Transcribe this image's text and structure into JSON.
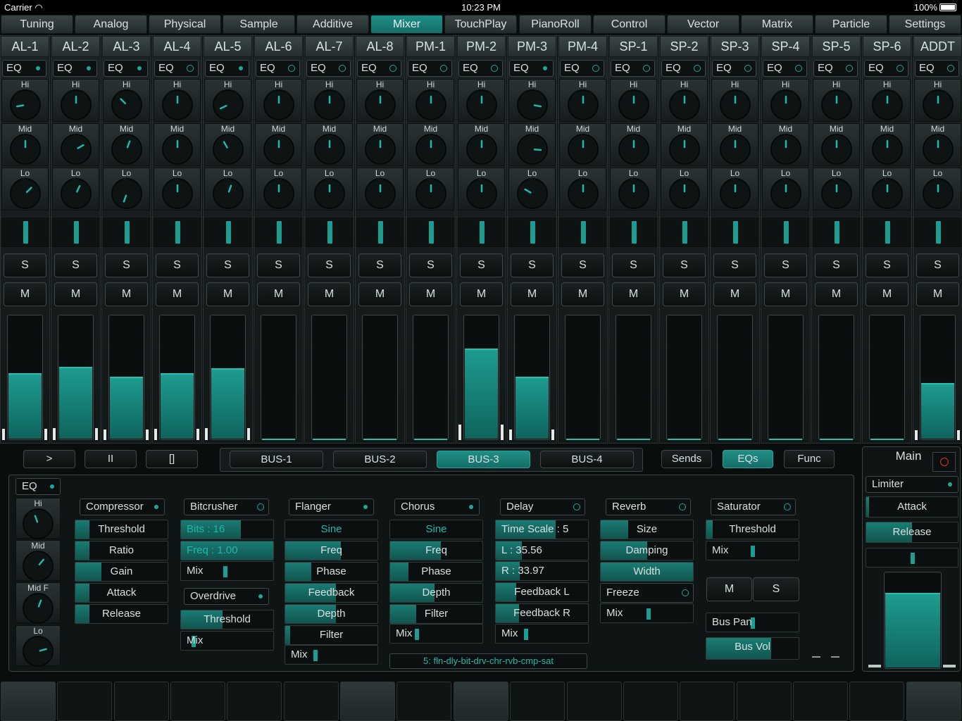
{
  "status": {
    "carrier": "Carrier",
    "time": "10:23 PM",
    "battery": "100%"
  },
  "tabs": [
    "Tuning",
    "Analog",
    "Physical",
    "Sample",
    "Additive",
    "Mixer",
    "TouchPlay",
    "PianoRoll",
    "Control",
    "Vector",
    "Matrix",
    "Particle",
    "Settings"
  ],
  "selected_tab": "Mixer",
  "channels": [
    {
      "name": "AL-1",
      "eq": "EQ",
      "eq_on": true,
      "hi": -100,
      "mid": 0,
      "lo": 45,
      "level": 0.53
    },
    {
      "name": "AL-2",
      "eq": "EQ",
      "eq_on": true,
      "hi": 0,
      "mid": 60,
      "lo": 25,
      "level": 0.58
    },
    {
      "name": "AL-3",
      "eq": "EQ",
      "eq_on": true,
      "hi": -45,
      "mid": 20,
      "lo": -160,
      "level": 0.5
    },
    {
      "name": "AL-4",
      "eq": "EQ",
      "eq_on": false,
      "hi": 0,
      "mid": 0,
      "lo": 0,
      "level": 0.53
    },
    {
      "name": "AL-5",
      "eq": "EQ",
      "eq_on": true,
      "hi": -115,
      "mid": -30,
      "lo": 20,
      "level": 0.57
    },
    {
      "name": "AL-6",
      "eq": "EQ",
      "eq_on": false,
      "hi": 0,
      "mid": 0,
      "lo": 0,
      "level": 0
    },
    {
      "name": "AL-7",
      "eq": "EQ",
      "eq_on": false,
      "hi": 0,
      "mid": 0,
      "lo": 0,
      "level": 0
    },
    {
      "name": "AL-8",
      "eq": "EQ",
      "eq_on": false,
      "hi": 0,
      "mid": 0,
      "lo": 0,
      "level": 0
    },
    {
      "name": "PM-1",
      "eq": "EQ",
      "eq_on": false,
      "hi": 0,
      "mid": 0,
      "lo": 0,
      "level": 0
    },
    {
      "name": "PM-2",
      "eq": "EQ",
      "eq_on": false,
      "hi": 0,
      "mid": 0,
      "lo": 0,
      "level": 0.73
    },
    {
      "name": "PM-3",
      "eq": "EQ",
      "eq_on": true,
      "hi": 100,
      "mid": 95,
      "lo": -60,
      "level": 0.5
    },
    {
      "name": "PM-4",
      "eq": "EQ",
      "eq_on": false,
      "hi": 0,
      "mid": 0,
      "lo": 0,
      "level": 0
    },
    {
      "name": "SP-1",
      "eq": "EQ",
      "eq_on": false,
      "hi": 0,
      "mid": 0,
      "lo": 0,
      "level": 0
    },
    {
      "name": "SP-2",
      "eq": "EQ",
      "eq_on": false,
      "hi": 0,
      "mid": 0,
      "lo": 0,
      "level": 0
    },
    {
      "name": "SP-3",
      "eq": "EQ",
      "eq_on": false,
      "hi": 0,
      "mid": 0,
      "lo": 0,
      "level": 0
    },
    {
      "name": "SP-4",
      "eq": "EQ",
      "eq_on": false,
      "hi": 0,
      "mid": 0,
      "lo": 0,
      "level": 0
    },
    {
      "name": "SP-5",
      "eq": "EQ",
      "eq_on": false,
      "hi": 0,
      "mid": 0,
      "lo": 0,
      "level": 0
    },
    {
      "name": "SP-6",
      "eq": "EQ",
      "eq_on": false,
      "hi": 0,
      "mid": 0,
      "lo": 0,
      "level": 0
    },
    {
      "name": "ADDT",
      "eq": "EQ",
      "eq_on": false,
      "hi": 0,
      "mid": 0,
      "lo": 0,
      "level": 0.45
    }
  ],
  "knob_labels": {
    "hi": "Hi",
    "mid": "Mid",
    "lo": "Lo",
    "midf": "Mid F"
  },
  "solo_label": "S",
  "mute_label": "M",
  "transport": [
    ">",
    "II",
    "[]"
  ],
  "buses": [
    "BUS-1",
    "BUS-2",
    "BUS-3",
    "BUS-4"
  ],
  "selected_bus": "BUS-3",
  "views": [
    "Sends",
    "EQs",
    "Func"
  ],
  "selected_view": "EQs",
  "bus_eq": {
    "label": "EQ",
    "on": true,
    "hi": -20,
    "mid": 40,
    "midf": 20,
    "lo": 75
  },
  "compressor": {
    "title": "Compressor",
    "on": true,
    "params": [
      {
        "label": "Threshold",
        "v": 0.15
      },
      {
        "label": "Ratio",
        "v": 0.15
      },
      {
        "label": "Gain",
        "v": 0.28
      },
      {
        "label": "Attack",
        "v": 0.15
      },
      {
        "label": "Release",
        "v": 0.15
      }
    ]
  },
  "bitcrusher": {
    "title": "Bitcrusher",
    "on": false,
    "bits": "Bits : 16",
    "bits_v": 0.65,
    "freq": "Freq : 1.00",
    "freq_v": 1.0,
    "mix": "Mix",
    "mix_v": 0.48
  },
  "overdrive": {
    "title": "Overdrive",
    "on": true,
    "threshold": "Threshold",
    "threshold_v": 0.45,
    "mix": "Mix",
    "mix_v": 0.12
  },
  "flanger": {
    "title": "Flanger",
    "on": true,
    "wave": "Sine",
    "params": [
      {
        "label": "Freq",
        "v": 0.6
      },
      {
        "label": "Phase",
        "v": 0.28
      },
      {
        "label": "Feedback",
        "v": 0.55
      },
      {
        "label": "Depth",
        "v": 0.55
      },
      {
        "label": "Filter",
        "v": 0.05
      }
    ],
    "mix": "Mix",
    "mix_v": 0.32
  },
  "chorus": {
    "title": "Chorus",
    "on": true,
    "wave": "Sine",
    "params": [
      {
        "label": "Freq",
        "v": 0.55
      },
      {
        "label": "Phase",
        "v": 0.2
      },
      {
        "label": "Depth",
        "v": 0.48
      },
      {
        "label": "Filter",
        "v": 0.28
      }
    ],
    "mix": "Mix",
    "mix_v": 0.28
  },
  "delay": {
    "title": "Delay",
    "on": false,
    "timescale": "Time Scale : 5",
    "timescale_v": 0.65,
    "l": "L : 35.56",
    "l_v": 0.28,
    "r": "R : 33.97",
    "r_v": 0.26,
    "feedback_l": "Feedback L",
    "feedback_l_v": 0.22,
    "feedback_r": "Feedback R",
    "feedback_r_v": 0.25,
    "mix": "Mix",
    "mix_v": 0.32
  },
  "reverb": {
    "title": "Reverb",
    "on": false,
    "params": [
      {
        "label": "Size",
        "v": 0.3
      },
      {
        "label": "Damping",
        "v": 0.5
      },
      {
        "label": "Width",
        "v": 1.0
      }
    ],
    "freeze": "Freeze",
    "freeze_on": false,
    "mix": "Mix",
    "mix_v": 0.52
  },
  "saturator": {
    "title": "Saturator",
    "on": false,
    "threshold": "Threshold",
    "threshold_v": 0.07,
    "mix": "Mix",
    "mix_v": 0.5
  },
  "bus_ms": {
    "m": "M",
    "s": "S"
  },
  "bus_pan": {
    "label": "Bus Pan",
    "v": 0.5
  },
  "bus_vol": {
    "label": "Bus Vol",
    "v": 0.7
  },
  "fx_chain": "5: fln-dly-bit-drv-chr-rvb-cmp-sat",
  "main": {
    "title": "Main",
    "limiter": "Limiter",
    "limiter_on": true,
    "attack": "Attack",
    "attack_v": 0.03,
    "release": "Release",
    "release_v": 0.5,
    "pan_v": 0.5,
    "level": 0.78
  },
  "pads": [
    true,
    false,
    false,
    false,
    false,
    false,
    true,
    false,
    true,
    false,
    false,
    false,
    false,
    false,
    false,
    false,
    true
  ]
}
